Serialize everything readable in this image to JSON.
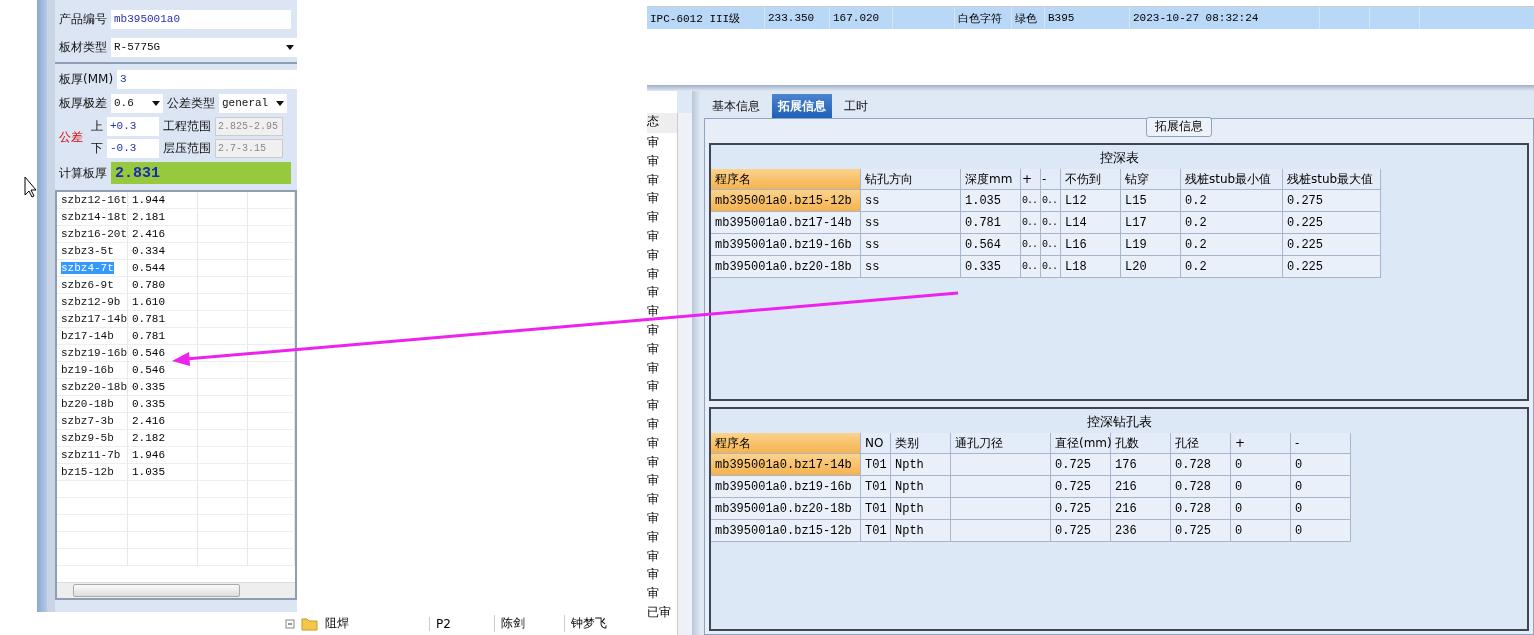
{
  "product": {
    "label": "产品编号",
    "value": "mb395001a0"
  },
  "board_type": {
    "label": "板材类型",
    "value": "R-5775G"
  },
  "thickness": {
    "label": "板厚(MM)",
    "value": "3"
  },
  "range": {
    "label": "板厚极差",
    "value": "0.6"
  },
  "tolerance_type": {
    "label": "公差类型",
    "value": "general"
  },
  "tolerance": {
    "label": "公差",
    "upper_label": "上",
    "upper": "+0.3",
    "lower_label": "下",
    "lower": "-0.3"
  },
  "eng_range": {
    "label": "工程范围",
    "value": "2.825-2.95",
    "disabled": true
  },
  "lam_range": {
    "label": "层压范围",
    "value": "2.7-3.15",
    "disabled": true
  },
  "calc": {
    "label": "计算板厚",
    "value": "2.831"
  },
  "thickness_list": [
    {
      "name": "szbz12-16t",
      "value": "1.944",
      "selected": false
    },
    {
      "name": "szbz14-18t",
      "value": "2.181",
      "selected": false
    },
    {
      "name": "szbz16-20t",
      "value": "2.416",
      "selected": false
    },
    {
      "name": "szbz3-5t",
      "value": "0.334",
      "selected": false
    },
    {
      "name": "szbz4-7t",
      "value": "0.544",
      "selected": true
    },
    {
      "name": "szbz6-9t",
      "value": "0.780",
      "selected": false
    },
    {
      "name": "szbz12-9b",
      "value": "1.610",
      "selected": false
    },
    {
      "name": "szbz17-14b",
      "value": "0.781",
      "selected": false
    },
    {
      "name": "bz17-14b",
      "value": "0.781",
      "selected": false
    },
    {
      "name": "szbz19-16b",
      "value": "0.546",
      "selected": false
    },
    {
      "name": "bz19-16b",
      "value": "0.546",
      "selected": false
    },
    {
      "name": "szbz20-18b",
      "value": "0.335",
      "selected": false
    },
    {
      "name": "bz20-18b",
      "value": "0.335",
      "selected": false
    },
    {
      "name": "szbz7-3b",
      "value": "2.416",
      "selected": false
    },
    {
      "name": "szbz9-5b",
      "value": "2.182",
      "selected": false
    },
    {
      "name": "szbz11-7b",
      "value": "1.946",
      "selected": false
    },
    {
      "name": "bz15-12b",
      "value": "1.035",
      "selected": false
    }
  ],
  "tree_row": {
    "cells": [
      "阻焊",
      "P2",
      "陈剑",
      "钟梦飞"
    ]
  },
  "grid_row": {
    "selected": true,
    "cells": [
      "IPC-6012 III级",
      "233.350",
      "167.020",
      "",
      "白色字符",
      "绿色",
      "B395",
      "2023-10-27 08:32:24",
      "",
      ""
    ]
  },
  "status_column": {
    "header": "态",
    "cells": [
      "审",
      "审",
      "审",
      "审",
      "审",
      "审",
      "审",
      "审",
      "审",
      "审",
      "审",
      "审",
      "审",
      "审",
      "审",
      "审",
      "审",
      "审",
      "审",
      "审",
      "审",
      "审",
      "审",
      "审",
      "审",
      "已审"
    ]
  },
  "tabs": [
    {
      "label": "基本信息",
      "selected": false
    },
    {
      "label": "拓展信息",
      "selected": true
    },
    {
      "label": "工时",
      "selected": false
    }
  ],
  "group_title": "拓展信息",
  "depth_table": {
    "title": "控深表",
    "columns": [
      "程序名",
      "钻孔方向",
      "深度mm",
      "+",
      "-",
      "不伤到",
      "钻穿",
      "残桩stub最小值",
      "残桩stub最大值"
    ],
    "rows": [
      {
        "selected": true,
        "cells": [
          "mb395001a0.bz15-12b",
          "ss",
          "1.035",
          "0..",
          "0..",
          "L12",
          "L15",
          "0.2",
          "0.275"
        ]
      },
      {
        "selected": false,
        "cells": [
          "mb395001a0.bz17-14b",
          "ss",
          "0.781",
          "0..",
          "0..",
          "L14",
          "L17",
          "0.2",
          "0.225"
        ]
      },
      {
        "selected": false,
        "cells": [
          "mb395001a0.bz19-16b",
          "ss",
          "0.564",
          "0..",
          "0..",
          "L16",
          "L19",
          "0.2",
          "0.225"
        ]
      },
      {
        "selected": false,
        "cells": [
          "mb395001a0.bz20-18b",
          "ss",
          "0.335",
          "0..",
          "0..",
          "L18",
          "L20",
          "0.2",
          "0.225"
        ]
      }
    ]
  },
  "drill_table": {
    "title": "控深钻孔表",
    "columns": [
      "程序名",
      "NO",
      "类别",
      "通孔刀径",
      "直径(mm)",
      "孔数",
      "孔径",
      "+",
      "-"
    ],
    "rows": [
      {
        "selected": true,
        "cells": [
          "mb395001a0.bz17-14b",
          "T01",
          "Npth",
          "",
          "0.725",
          "176",
          "0.728",
          "0",
          "0"
        ]
      },
      {
        "selected": false,
        "cells": [
          "mb395001a0.bz19-16b",
          "T01",
          "Npth",
          "",
          "0.725",
          "216",
          "0.728",
          "0",
          "0"
        ]
      },
      {
        "selected": false,
        "cells": [
          "mb395001a0.bz20-18b",
          "T01",
          "Npth",
          "",
          "0.725",
          "216",
          "0.728",
          "0",
          "0"
        ]
      },
      {
        "selected": false,
        "cells": [
          "mb395001a0.bz15-12b",
          "T01",
          "Npth",
          "",
          "0.725",
          "236",
          "0.725",
          "0",
          "0"
        ]
      }
    ]
  }
}
